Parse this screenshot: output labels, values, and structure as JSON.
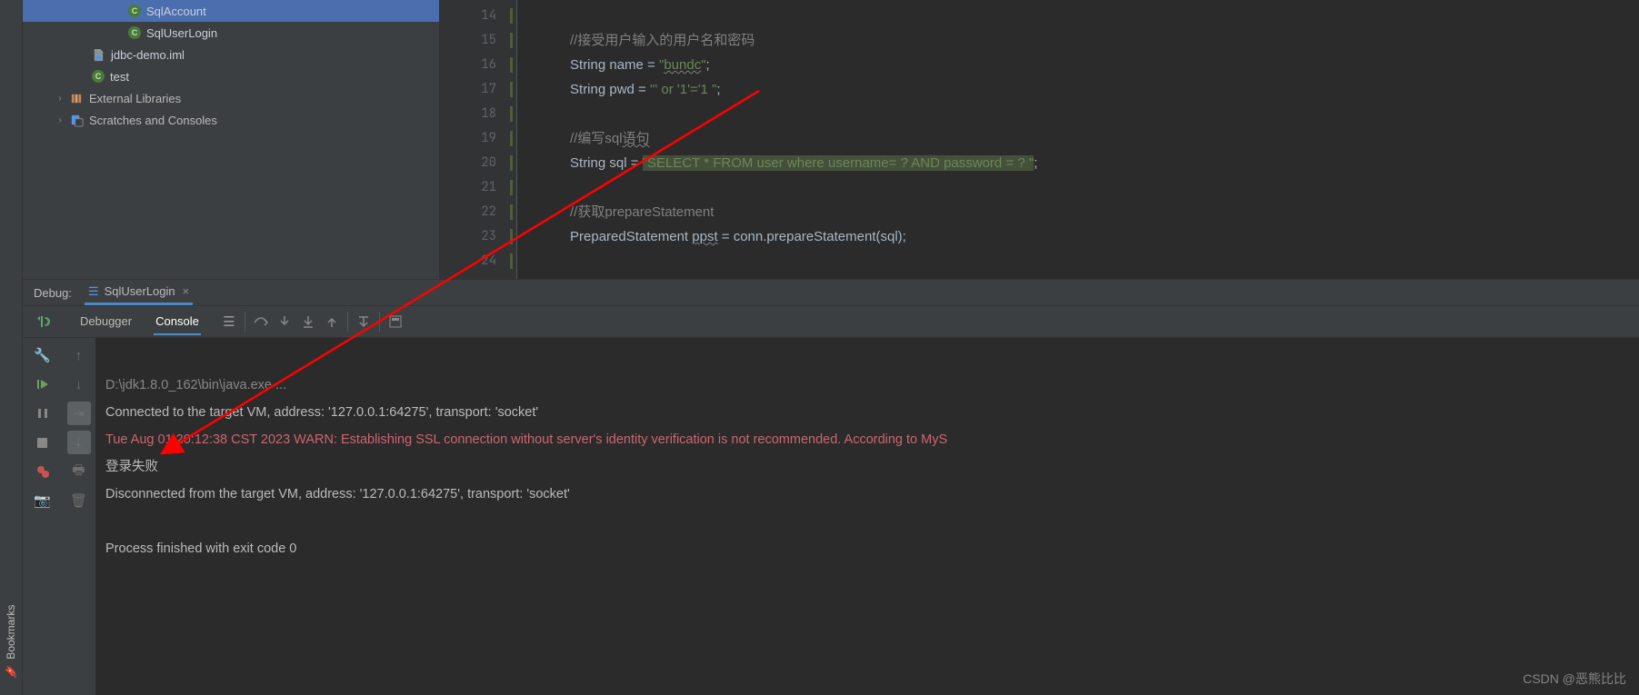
{
  "watermark": "CSDN @恶熊比比",
  "left_rail": {
    "bookmarks": "Bookmarks"
  },
  "tree": {
    "items": [
      {
        "indent": 110,
        "icon": "class",
        "label": "SqlAccount",
        "selected": true
      },
      {
        "indent": 110,
        "icon": "class",
        "label": "SqlUserLogin"
      },
      {
        "indent": 70,
        "icon": "module",
        "label": "jdbc-demo.iml"
      },
      {
        "indent": 70,
        "icon": "class",
        "label": "test"
      }
    ],
    "external_libraries": "External Libraries",
    "scratches": "Scratches and Consoles"
  },
  "gutter": {
    "start": 14,
    "end": 24
  },
  "code": {
    "l14": "",
    "l15": {
      "pad": "            ",
      "comment": "//接受用户输入的用户名和密码"
    },
    "l16": {
      "pad": "            ",
      "kw": "String ",
      "var": "name = ",
      "q": "\"",
      "str": "bundc",
      "q2": "\";"
    },
    "l17": {
      "pad": "            ",
      "kw": "String ",
      "var": "pwd = ",
      "str": "\"' or '1'='1 \"",
      "semi": ";"
    },
    "l18": "",
    "l19": {
      "pad": "            ",
      "comment": "//编写sql语句"
    },
    "l20": {
      "pad": "            ",
      "kw": "String ",
      "var": "sql = ",
      "str": "\"SELECT * FROM user where username= ? AND password = ? \"",
      "semi": ";"
    },
    "l21": "",
    "l22": {
      "pad": "            ",
      "comment": "//获取prepareStatement"
    },
    "l23": {
      "pad": "            ",
      "type": "PreparedStatement ",
      "var": "ppst",
      " eq": " = conn.",
      "method": "prepareStatement",
      "tail": "(sql);"
    },
    "l24": ""
  },
  "debug": {
    "label": "Debug:",
    "tab_icon": "run-config",
    "tab": "SqlUserLogin",
    "view_debugger": "Debugger",
    "view_console": "Console"
  },
  "console": {
    "l1": "D:\\jdk1.8.0_162\\bin\\java.exe ...",
    "l2": "Connected to the target VM, address: '127.0.0.1:64275', transport: 'socket'",
    "l3": "Tue Aug 01 20:12:38 CST 2023 WARN: Establishing SSL connection without server's identity verification is not recommended. According to MyS",
    "l4": "登录失败",
    "l5": "Disconnected from the target VM, address: '127.0.0.1:64275', transport: 'socket'",
    "l6": "",
    "l7": "Process finished with exit code 0"
  }
}
